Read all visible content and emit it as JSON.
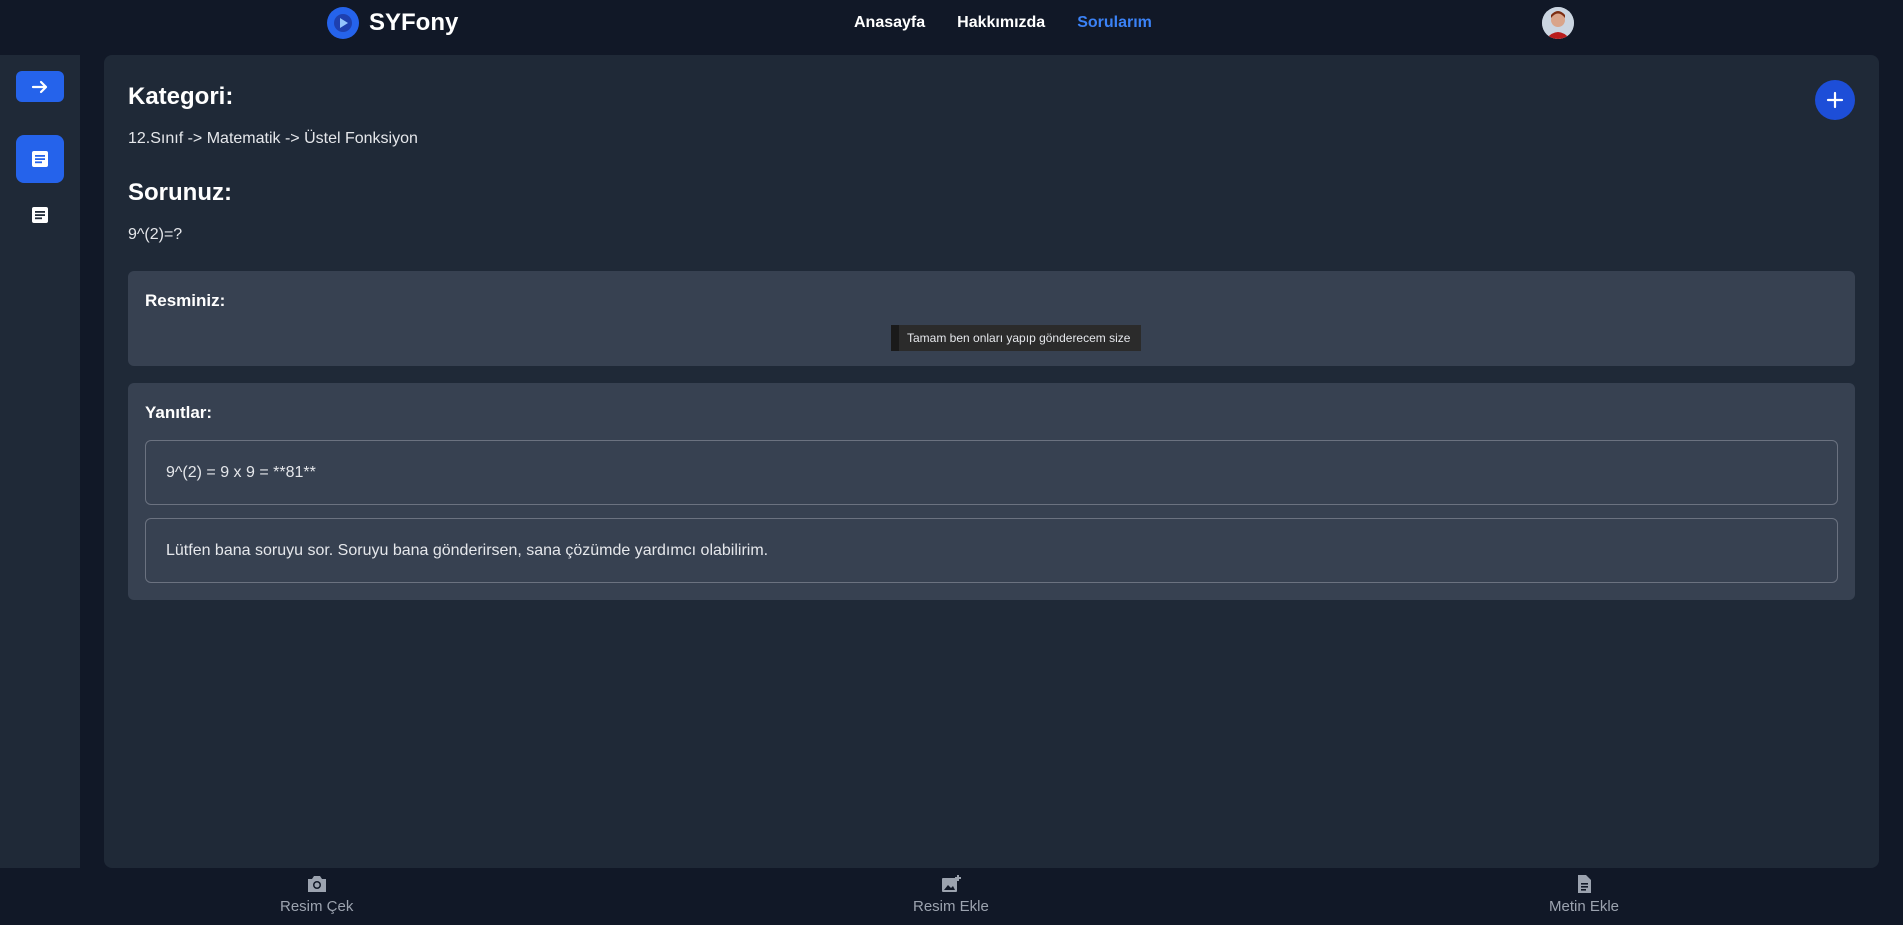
{
  "navbar": {
    "brand": "SYFony",
    "links": [
      {
        "label": "Anasayfa",
        "active": false
      },
      {
        "label": "Hakkımızda",
        "active": false
      },
      {
        "label": "Sorularım",
        "active": true
      }
    ]
  },
  "main": {
    "category_title": "Kategori:",
    "category_path": "12.Sınıf -> Matematik -> Üstel Fonksiyon",
    "question_title": "Sorunuz:",
    "question_text": "9^(2)=?",
    "image_card": {
      "title": "Resminiz:",
      "image_caption": "Tamam ben onları yapıp gönderecem size"
    },
    "answers_card": {
      "title": "Yanıtlar:",
      "answers": [
        "9^(2) = 9 x 9 = **81**",
        "Lütfen bana soruyu sor. Soruyu bana gönderirsen, sana çözümde yardımcı olabilirim."
      ]
    }
  },
  "bottom_bar": {
    "items": [
      {
        "label": "Resim Çek",
        "icon": "camera-icon"
      },
      {
        "label": "Resim Ekle",
        "icon": "add-photo-icon"
      },
      {
        "label": "Metin Ekle",
        "icon": "document-icon"
      }
    ]
  },
  "colors": {
    "accent": "#2563eb",
    "active_link": "#3b82f6",
    "background": "#111827",
    "panel": "#1f2937",
    "card": "#374151"
  }
}
